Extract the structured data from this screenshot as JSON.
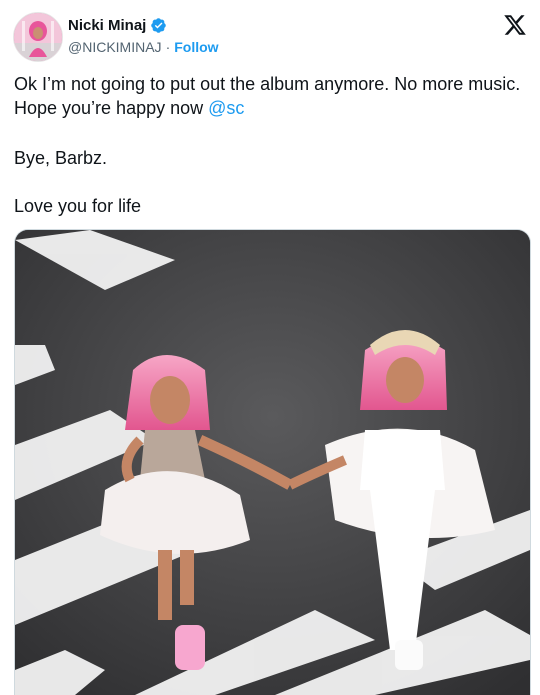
{
  "author": {
    "display_name": "Nicki Minaj",
    "handle": "@NICKIMINAJ",
    "separator": "·",
    "follow_label": "Follow"
  },
  "tweet": {
    "line1_before_mention": "Ok I’m not going to put out the album anymore. No more music. Hope you’re happy now ",
    "mention": "@sc",
    "paragraph2": "Bye, Barbz.",
    "paragraph3": "Love you for life"
  },
  "colors": {
    "link_blue": "#1d9bf0",
    "secondary_text": "#536471",
    "primary_text": "#0f1419"
  },
  "icons": {
    "verified": "verified-badge-icon",
    "platform": "x-logo-icon"
  },
  "media": {
    "description_hidden": ""
  }
}
